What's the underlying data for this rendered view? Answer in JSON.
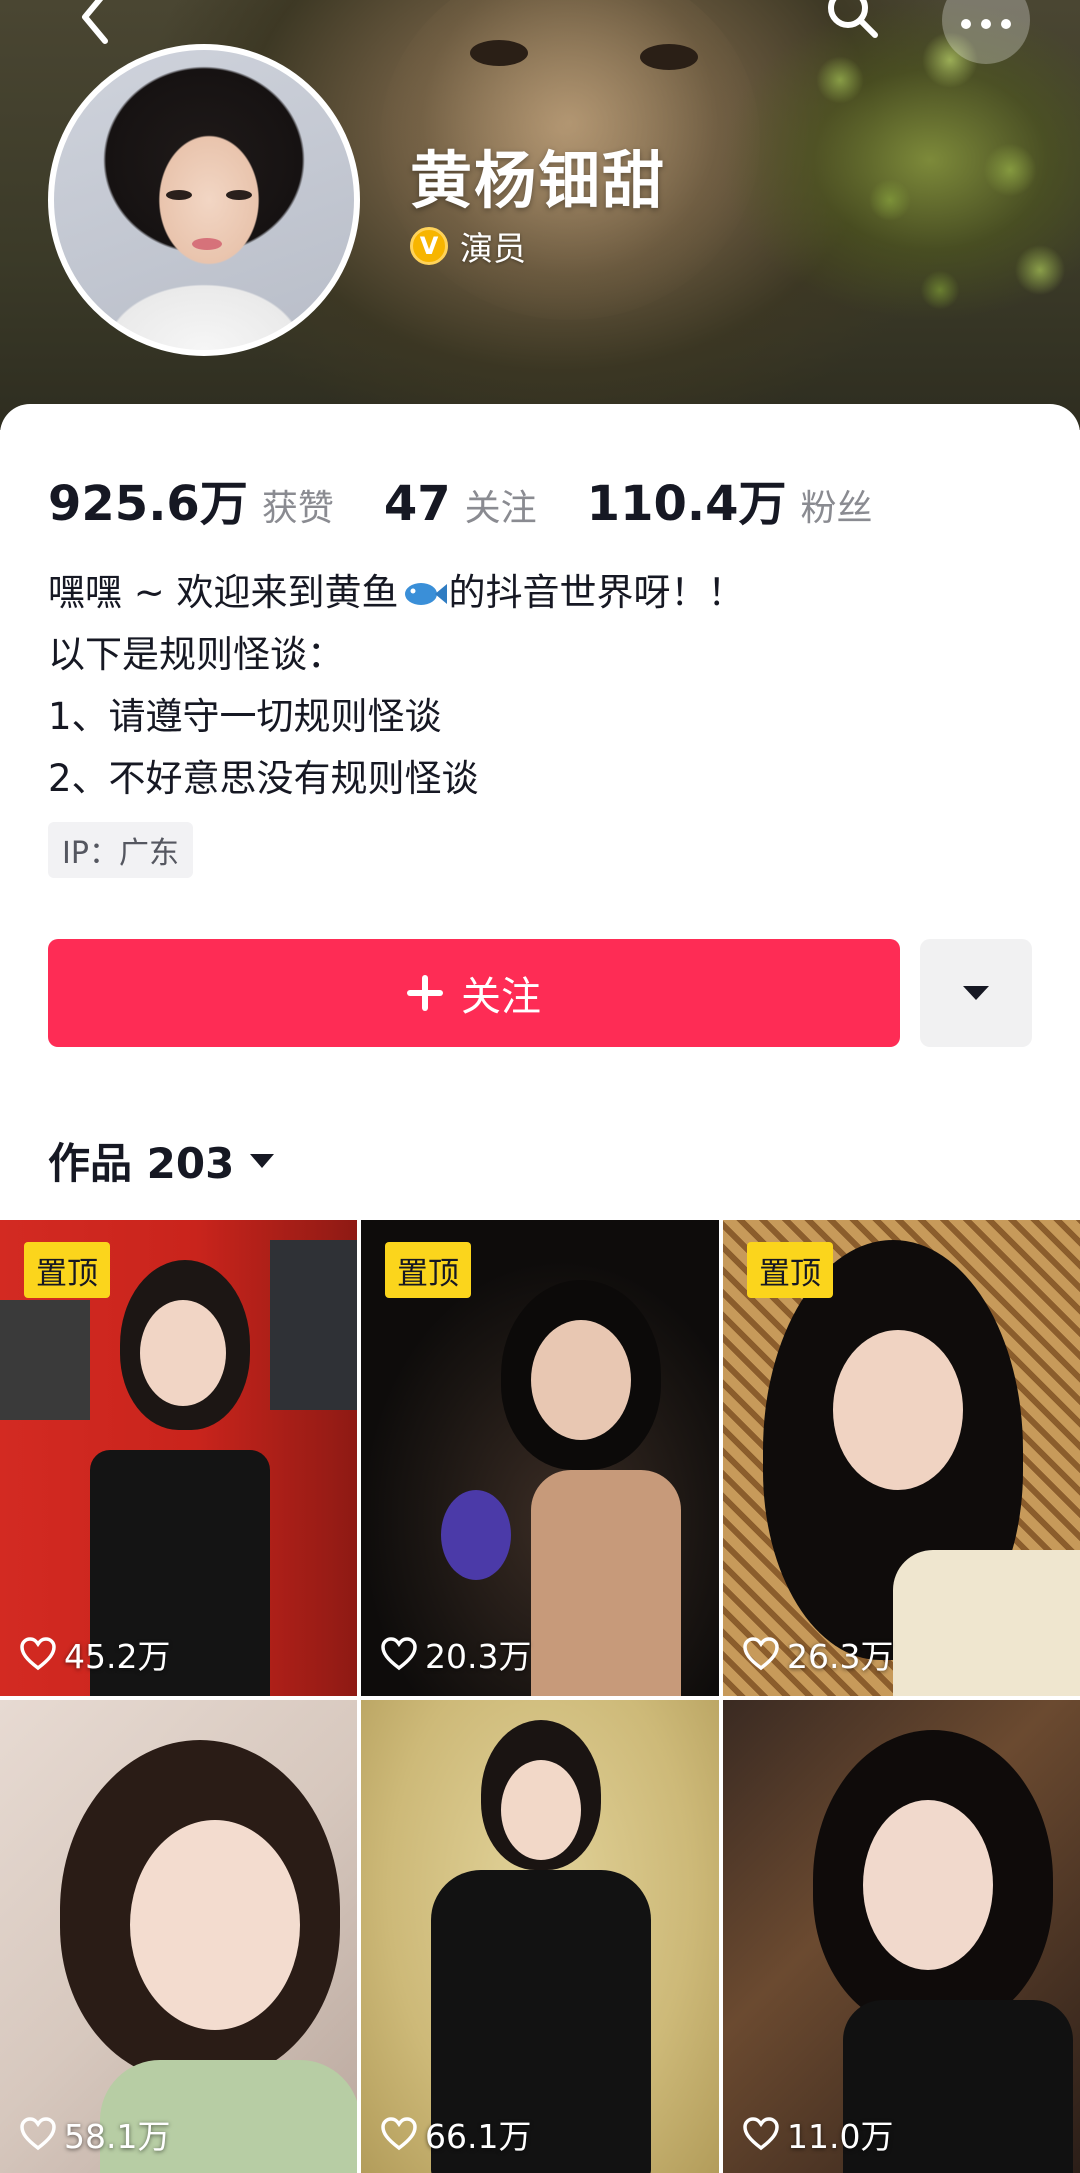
{
  "header": {
    "back_icon": "chevron-left-icon",
    "search_icon": "search-icon",
    "more_icon": "more-dots-icon"
  },
  "profile": {
    "name": "黄杨钿甜",
    "verified_badge": "V",
    "verified_label": "演员",
    "verified_color": "#f7b500"
  },
  "stats": [
    {
      "value": "925.6万",
      "label": "获赞"
    },
    {
      "value": "47",
      "label": "关注"
    },
    {
      "value": "110.4万",
      "label": "粉丝"
    }
  ],
  "bio": {
    "line1_before": "嘿嘿 ~ 欢迎来到黄鱼",
    "line1_after": "的抖音世界呀！！",
    "line2": "以下是规则怪谈：",
    "line3": "1、请遵守一切规则怪谈",
    "line4": "2、不好意思没有规则怪谈"
  },
  "ip": "IP：广东",
  "follow_button": {
    "label": "关注",
    "color": "#fe2c55"
  },
  "works_tab": {
    "label": "作品 203"
  },
  "videos": [
    {
      "pinned": "置顶",
      "likes": "45.2万"
    },
    {
      "pinned": "置顶",
      "likes": "20.3万"
    },
    {
      "pinned": "置顶",
      "likes": "26.3万"
    },
    {
      "pinned": "",
      "likes": "58.1万"
    },
    {
      "pinned": "",
      "likes": "66.1万"
    },
    {
      "pinned": "",
      "likes": "11.0万"
    }
  ]
}
